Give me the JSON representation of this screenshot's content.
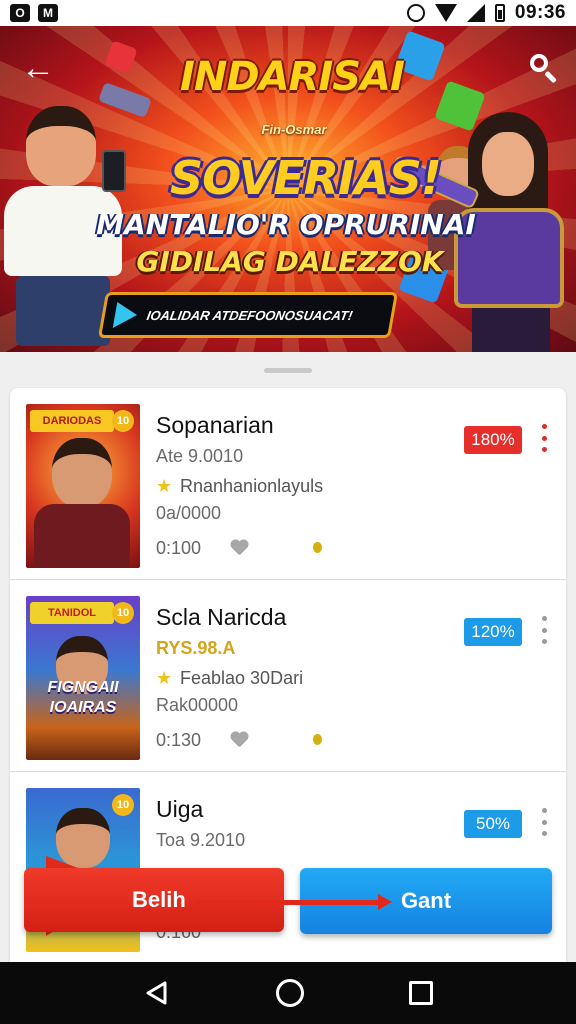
{
  "status_bar": {
    "time": "09:36",
    "app_icon_1": "O",
    "app_icon_2": "M"
  },
  "banner": {
    "title": "INDARISAI",
    "emblem_text": "Fin-Osmar",
    "logo": "SOVERIAS!",
    "line1": "MANTALIO'R OPRURINAI",
    "line2": "GIDILAG DALEZZOK",
    "cta_text": "IOALIDAR ATDEFOONOSUACAT!",
    "back_icon": "back-arrow-icon",
    "search_icon": "search-icon"
  },
  "list": {
    "items": [
      {
        "title": "Sopanarian",
        "subtitle": "Ate 9.0010",
        "rating_text": "Rnanhanionlayuls",
        "count": "0a/0000",
        "time": "0:100",
        "percent": "180%",
        "percent_color": "#e62e2b",
        "thumb_tag": "DARIODAS",
        "thumb_badge": "10",
        "thumb_caption": ""
      },
      {
        "title": "Scla Naricda",
        "subtitle": "RYS.98.A",
        "rating_text": "Feablao 30Dari",
        "count": "Rak00000",
        "time": "0:130",
        "percent": "120%",
        "percent_color": "#1b9be8",
        "thumb_tag": "TANIDOL",
        "thumb_badge": "10",
        "thumb_caption": "FIGNGAII\nIOAIRAS"
      },
      {
        "title": "Uiga",
        "subtitle": "Toa 9.2010",
        "time": "0:160",
        "percent": "50%",
        "percent_color": "#1b9be8",
        "thumb_badge": "10"
      }
    ]
  },
  "buttons": {
    "left": "Belih",
    "right": "Gant"
  },
  "colors": {
    "accent_red": "#e62e2b",
    "accent_blue": "#1b9be8"
  }
}
